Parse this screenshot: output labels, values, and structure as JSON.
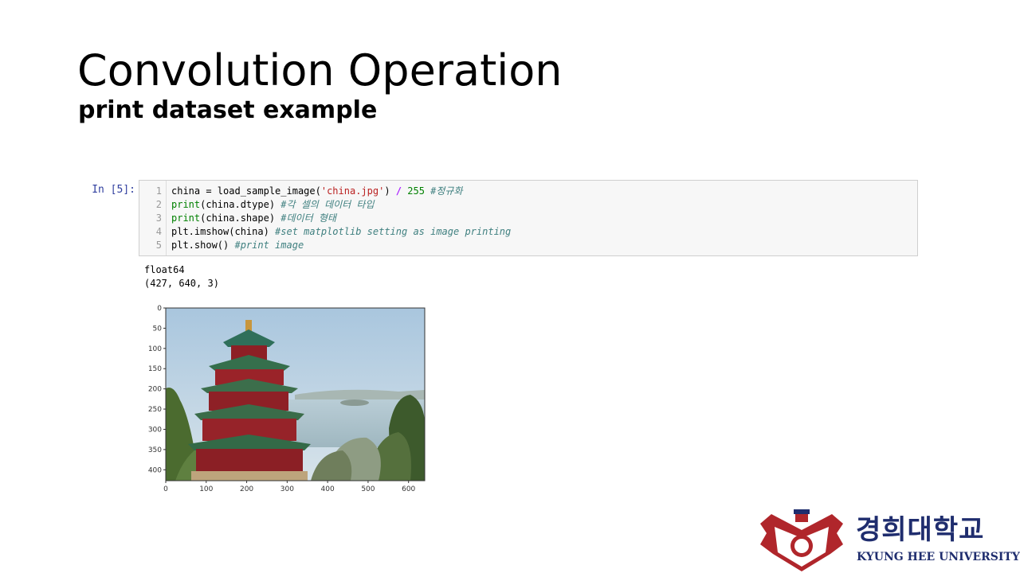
{
  "slide": {
    "title": "Convolution Operation",
    "subtitle": "print dataset example"
  },
  "notebook": {
    "prompt": "In [5]:",
    "code_lines": [
      {
        "num": "1",
        "tokens": [
          {
            "t": "china = load_sample_image(",
            "c": ""
          },
          {
            "t": "'china.jpg'",
            "c": "str"
          },
          {
            "t": ") ",
            "c": ""
          },
          {
            "t": "/",
            "c": "op"
          },
          {
            "t": " ",
            "c": ""
          },
          {
            "t": "255",
            "c": "num"
          },
          {
            "t": " ",
            "c": ""
          },
          {
            "t": "#정규화",
            "c": "cm"
          }
        ]
      },
      {
        "num": "2",
        "tokens": [
          {
            "t": "print",
            "c": "kw"
          },
          {
            "t": "(china.dtype) ",
            "c": ""
          },
          {
            "t": "#각 셀의 데이터 타입",
            "c": "cm"
          }
        ]
      },
      {
        "num": "3",
        "tokens": [
          {
            "t": "print",
            "c": "kw"
          },
          {
            "t": "(china.shape) ",
            "c": ""
          },
          {
            "t": "#데이터 형태",
            "c": "cm"
          }
        ]
      },
      {
        "num": "4",
        "tokens": [
          {
            "t": "plt.imshow(china) ",
            "c": ""
          },
          {
            "t": "#set matplotlib setting as image printing",
            "c": "cm"
          }
        ]
      },
      {
        "num": "5",
        "tokens": [
          {
            "t": "plt.show() ",
            "c": ""
          },
          {
            "t": "#print image",
            "c": "cm"
          }
        ]
      }
    ],
    "output_lines": [
      "float64",
      "(427, 640, 3)"
    ]
  },
  "chart_data": {
    "type": "image",
    "image_description": "Photo of a multi-tiered Chinese pagoda (Summer Palace) overlooking a lake with trees",
    "image_shape": [
      427,
      640,
      3
    ],
    "xlim": [
      0,
      640
    ],
    "ylim": [
      427,
      0
    ],
    "x_ticks": [
      0,
      100,
      200,
      300,
      400,
      500,
      600
    ],
    "y_ticks": [
      0,
      50,
      100,
      150,
      200,
      250,
      300,
      350,
      400
    ]
  },
  "logo": {
    "korean": "경희대학교",
    "english": "KYUNG HEE UNIVERSITY",
    "colors": {
      "primary": "#1f2d6e",
      "emblem": "#b0262b"
    }
  }
}
